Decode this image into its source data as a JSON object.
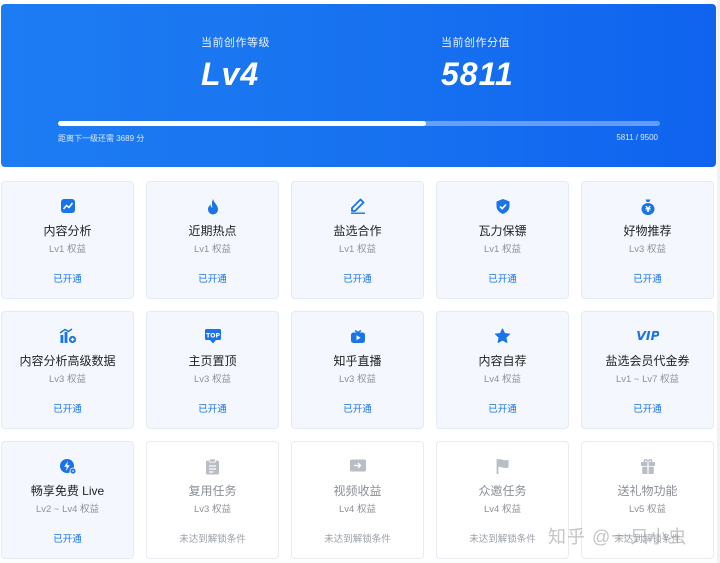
{
  "header": {
    "level_label": "当前创作等级",
    "level_value": "Lv4",
    "score_label": "当前创作分值",
    "score_value": "5811",
    "progress_note": "距离下一级还需 3689 分",
    "progress_ratio": "5811 / 9500",
    "progress_fraction": 0.612
  },
  "cards": [
    {
      "icon": "chart-icon",
      "title": "内容分析",
      "sub": "Lv1 权益",
      "status": "已开通",
      "locked": false
    },
    {
      "icon": "flame-icon",
      "title": "近期热点",
      "sub": "Lv1 权益",
      "status": "已开通",
      "locked": false
    },
    {
      "icon": "pen-icon",
      "title": "盐选合作",
      "sub": "Lv1 权益",
      "status": "已开通",
      "locked": false
    },
    {
      "icon": "shield-icon",
      "title": "瓦力保镖",
      "sub": "Lv1 权益",
      "status": "已开通",
      "locked": false
    },
    {
      "icon": "money-bag-icon",
      "title": "好物推荐",
      "sub": "Lv3 权益",
      "status": "已开通",
      "locked": false
    },
    {
      "icon": "bar-chart-plus-icon",
      "title": "内容分析高级数据",
      "sub": "Lv3 权益",
      "status": "已开通",
      "locked": false
    },
    {
      "icon": "top-badge-icon",
      "title": "主页置顶",
      "sub": "Lv3 权益",
      "status": "已开通",
      "locked": false
    },
    {
      "icon": "live-tv-icon",
      "title": "知乎直播",
      "sub": "Lv3 权益",
      "status": "已开通",
      "locked": false
    },
    {
      "icon": "star-icon",
      "title": "内容自荐",
      "sub": "Lv4 权益",
      "status": "已开通",
      "locked": false
    },
    {
      "icon": "vip-icon",
      "title": "盐选会员代金券",
      "sub": "Lv1 ~ Lv7 权益",
      "status": "已开通",
      "locked": false
    },
    {
      "icon": "lightning-icon",
      "title": "畅享免费 Live",
      "sub": "Lv2 ~ Lv4 权益",
      "status": "已开通",
      "locked": false
    },
    {
      "icon": "clipboard-icon",
      "title": "复用任务",
      "sub": "Lv3 权益",
      "status": "未达到解锁条件",
      "locked": true
    },
    {
      "icon": "video-income-icon",
      "title": "视频收益",
      "sub": "Lv4 权益",
      "status": "未达到解锁条件",
      "locked": true
    },
    {
      "icon": "flag-icon",
      "title": "众邀任务",
      "sub": "Lv4 权益",
      "status": "未达到解锁条件",
      "locked": true
    },
    {
      "icon": "gift-icon",
      "title": "送礼物功能",
      "sub": "Lv5 权益",
      "status": "未达到解锁条件",
      "locked": true
    }
  ],
  "watermark": "知乎 @一只小虫",
  "colors": {
    "accent": "#1a73e8",
    "locked": "#b9bec6",
    "banner": "#1771f0"
  }
}
